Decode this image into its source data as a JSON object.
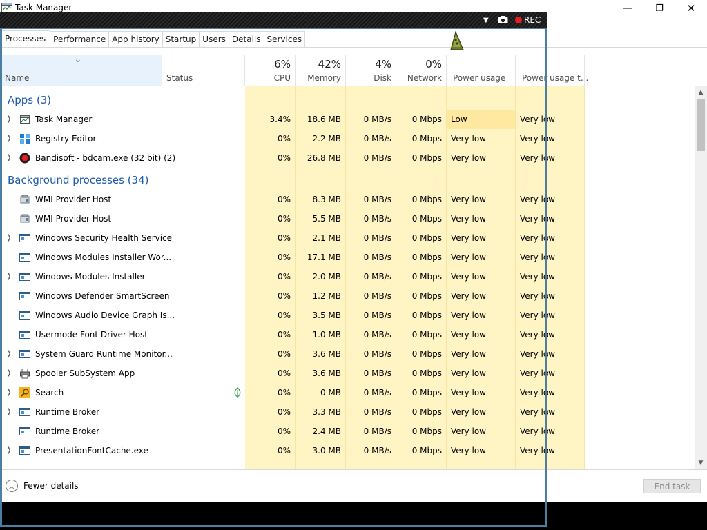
{
  "window": {
    "title": "Task Manager",
    "minimize_glyph": "—",
    "maximize_glyph": "❐",
    "close_glyph": "✕"
  },
  "recorder": {
    "dropdown_glyph": "▼",
    "camera_glyph": "📷",
    "rec_label": "REC",
    "rec_color": "#e81e1e"
  },
  "tabs": [
    {
      "label": "Processes",
      "active": true
    },
    {
      "label": "Performance"
    },
    {
      "label": "App history"
    },
    {
      "label": "Startup"
    },
    {
      "label": "Users"
    },
    {
      "label": "Details"
    },
    {
      "label": "Services"
    }
  ],
  "columns": {
    "name": {
      "label": "Name",
      "sort_glyph": "⌄"
    },
    "status": {
      "label": "Status"
    },
    "cpu": {
      "label": "CPU",
      "pct": "6%"
    },
    "memory": {
      "label": "Memory",
      "pct": "42%"
    },
    "disk": {
      "label": "Disk",
      "pct": "4%"
    },
    "network": {
      "label": "Network",
      "pct": "0%"
    },
    "power": {
      "label": "Power usage"
    },
    "power_trend": {
      "label": "Power usage t..."
    }
  },
  "groups": {
    "apps": "Apps (3)",
    "background": "Background processes (34)"
  },
  "apps": [
    {
      "name": "Task Manager",
      "icon": "task-manager-icon",
      "cpu": "3.4%",
      "mem": "18.6 MB",
      "disk": "0 MB/s",
      "net": "0 Mbps",
      "power": "Low",
      "trend": "Very low",
      "expand": true
    },
    {
      "name": "Registry Editor",
      "icon": "registry-editor-icon",
      "cpu": "0%",
      "mem": "2.2 MB",
      "disk": "0 MB/s",
      "net": "0 Mbps",
      "power": "Very low",
      "trend": "Very low",
      "expand": true
    },
    {
      "name": "Bandisoft - bdcam.exe (32 bit) (2)",
      "icon": "bandicam-icon",
      "cpu": "0%",
      "mem": "26.8 MB",
      "disk": "0 MB/s",
      "net": "0 Mbps",
      "power": "Very low",
      "trend": "Very low",
      "expand": true
    }
  ],
  "background": [
    {
      "name": "WMI Provider Host",
      "icon": "wmi-icon",
      "cpu": "0%",
      "mem": "8.3 MB",
      "disk": "0 MB/s",
      "net": "0 Mbps",
      "power": "Very low",
      "trend": "Very low",
      "expand": false
    },
    {
      "name": "WMI Provider Host",
      "icon": "wmi-icon",
      "cpu": "0%",
      "mem": "5.5 MB",
      "disk": "0 MB/s",
      "net": "0 Mbps",
      "power": "Very low",
      "trend": "Very low",
      "expand": false
    },
    {
      "name": "Windows Security Health Service",
      "icon": "service-window-icon",
      "cpu": "0%",
      "mem": "2.1 MB",
      "disk": "0 MB/s",
      "net": "0 Mbps",
      "power": "Very low",
      "trend": "Very low",
      "expand": true
    },
    {
      "name": "Windows Modules Installer Wor...",
      "icon": "service-window-icon",
      "cpu": "0%",
      "mem": "17.1 MB",
      "disk": "0 MB/s",
      "net": "0 Mbps",
      "power": "Very low",
      "trend": "Very low",
      "expand": false
    },
    {
      "name": "Windows Modules Installer",
      "icon": "service-window-icon",
      "cpu": "0%",
      "mem": "2.0 MB",
      "disk": "0 MB/s",
      "net": "0 Mbps",
      "power": "Very low",
      "trend": "Very low",
      "expand": true
    },
    {
      "name": "Windows Defender SmartScreen",
      "icon": "service-window-icon",
      "cpu": "0%",
      "mem": "1.2 MB",
      "disk": "0 MB/s",
      "net": "0 Mbps",
      "power": "Very low",
      "trend": "Very low",
      "expand": false
    },
    {
      "name": "Windows Audio Device Graph Is...",
      "icon": "service-window-icon",
      "cpu": "0%",
      "mem": "3.5 MB",
      "disk": "0 MB/s",
      "net": "0 Mbps",
      "power": "Very low",
      "trend": "Very low",
      "expand": false
    },
    {
      "name": "Usermode Font Driver Host",
      "icon": "service-window-icon",
      "cpu": "0%",
      "mem": "1.0 MB",
      "disk": "0 MB/s",
      "net": "0 Mbps",
      "power": "Very low",
      "trend": "Very low",
      "expand": false
    },
    {
      "name": "System Guard Runtime Monitor...",
      "icon": "service-window-icon",
      "cpu": "0%",
      "mem": "3.6 MB",
      "disk": "0 MB/s",
      "net": "0 Mbps",
      "power": "Very low",
      "trend": "Very low",
      "expand": true
    },
    {
      "name": "Spooler SubSystem App",
      "icon": "printer-icon",
      "cpu": "0%",
      "mem": "3.6 MB",
      "disk": "0 MB/s",
      "net": "0 Mbps",
      "power": "Very low",
      "trend": "Very low",
      "expand": true
    },
    {
      "name": "Search",
      "icon": "search-icon",
      "cpu": "0%",
      "mem": "0 MB",
      "disk": "0 MB/s",
      "net": "0 Mbps",
      "power": "Very low",
      "trend": "Very low",
      "expand": true,
      "status_icon": "leaf-icon"
    },
    {
      "name": "Runtime Broker",
      "icon": "service-window-icon",
      "cpu": "0%",
      "mem": "3.3 MB",
      "disk": "0 MB/s",
      "net": "0 Mbps",
      "power": "Very low",
      "trend": "Very low",
      "expand": true
    },
    {
      "name": "Runtime Broker",
      "icon": "service-window-icon",
      "cpu": "0%",
      "mem": "2.4 MB",
      "disk": "0 MB/s",
      "net": "0 Mbps",
      "power": "Very low",
      "trend": "Very low",
      "expand": false
    },
    {
      "name": "PresentationFontCache.exe",
      "icon": "service-window-icon",
      "cpu": "0%",
      "mem": "3.0 MB",
      "disk": "0 MB/s",
      "net": "0 Mbps",
      "power": "Very low",
      "trend": "Very low",
      "expand": true
    }
  ],
  "footer": {
    "fewer_details": "Fewer details",
    "fewer_glyph": "︿",
    "end_task": "End task"
  },
  "colors": {
    "group_header": "#1e5aa8",
    "heat_low": "#fff4c4",
    "heat_medium": "#ffe8a0",
    "capture_frame": "#4a7ea3"
  }
}
